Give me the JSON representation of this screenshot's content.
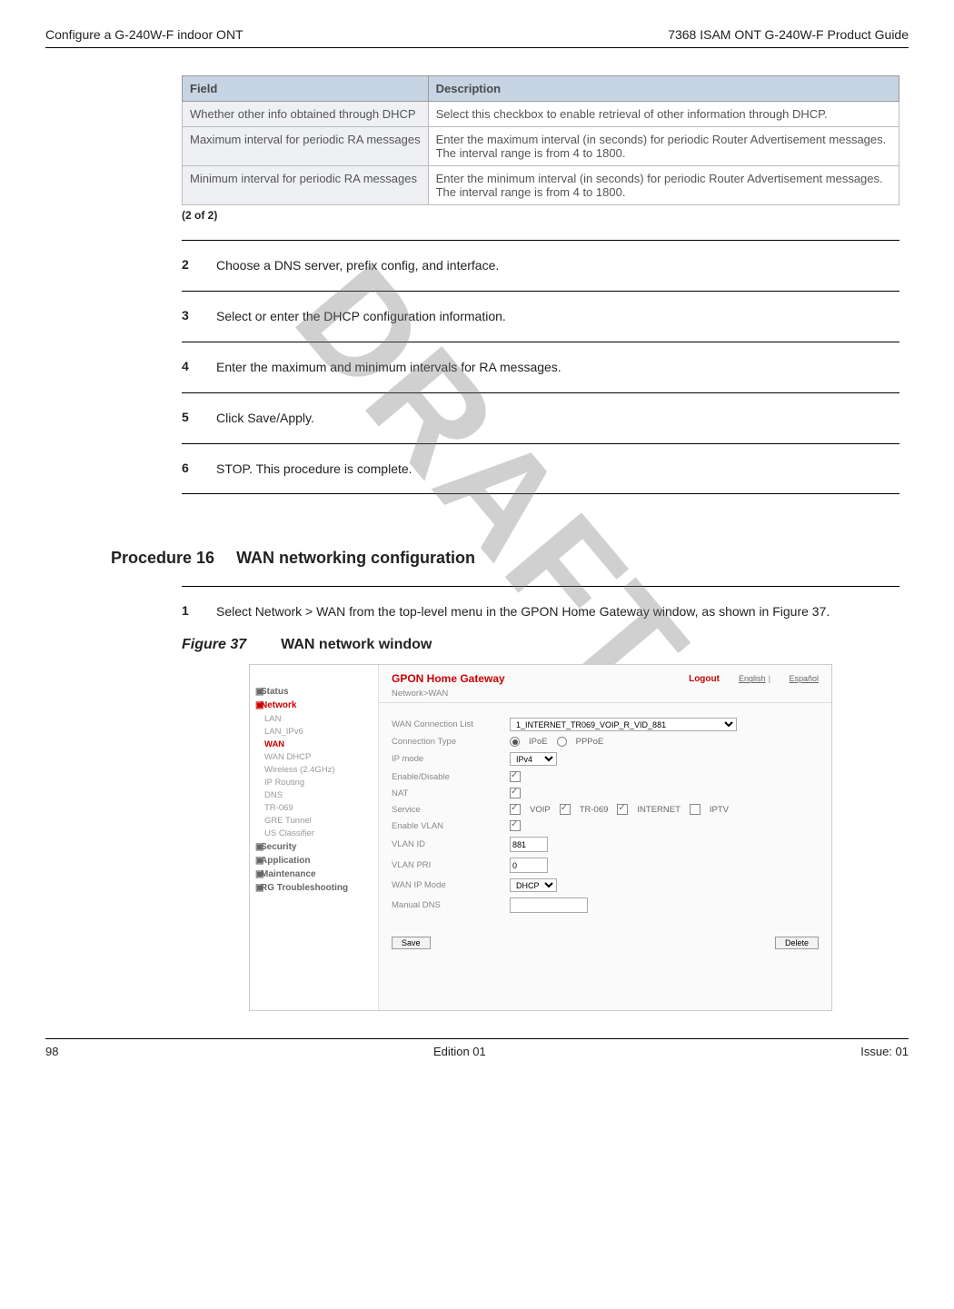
{
  "header": {
    "left": "Configure a G-240W-F indoor ONT",
    "right": "7368 ISAM ONT G-240W-F Product Guide"
  },
  "table": {
    "col1": "Field",
    "col2": "Description",
    "rows": [
      {
        "f": "Whether other info obtained through DHCP",
        "d": "Select this checkbox to enable retrieval of other information through DHCP."
      },
      {
        "f": "Maximum interval for periodic RA messages",
        "d": "Enter the maximum interval (in seconds) for periodic Router Advertisement messages. The interval range is from 4 to 1800."
      },
      {
        "f": "Minimum interval for periodic RA messages",
        "d": "Enter the minimum interval (in seconds) for periodic Router Advertisement messages. The interval range is from 4 to 1800."
      }
    ],
    "caption": "(2 of 2)"
  },
  "steps": [
    {
      "n": "2",
      "t": "Choose a DNS server, prefix config, and interface."
    },
    {
      "n": "3",
      "t": "Select or enter the DHCP configuration information."
    },
    {
      "n": "4",
      "t": "Enter the maximum and minimum intervals for RA messages."
    },
    {
      "n": "5",
      "t": "Click Save/Apply."
    },
    {
      "n": "6",
      "t": "STOP. This procedure is complete."
    }
  ],
  "procedure": {
    "label": "Procedure 16",
    "title": "WAN networking configuration",
    "step1_n": "1",
    "step1_t": "Select Network > WAN from the top-level menu in the GPON Home Gateway window, as shown in Figure 37."
  },
  "figure": {
    "label": "Figure 37",
    "title": "WAN network window"
  },
  "ui": {
    "title": "GPON Home Gateway",
    "logout": "Logout",
    "lang1": "English",
    "lang2": "Español",
    "crumb": "Network>WAN",
    "sidebar": {
      "status": "Status",
      "network": "Network",
      "items": [
        "LAN",
        "LAN_IPv6",
        "WAN",
        "WAN DHCP",
        "Wireless (2.4GHz)",
        "IP Routing",
        "DNS",
        "TR-069",
        "GRE Tunnel",
        "US Classifier"
      ],
      "security": "Security",
      "application": "Application",
      "maintenance": "Maintenance",
      "rgtrouble": "RG Troubleshooting"
    },
    "form": {
      "wan_conn_label": "WAN Connection List",
      "wan_conn_value": "1_INTERNET_TR069_VOIP_R_VID_881",
      "conn_type_label": "Connection Type",
      "ipoe": "IPoE",
      "pppoe": "PPPoE",
      "ip_mode_label": "IP mode",
      "ip_mode_value": "IPv4",
      "enable_label": "Enable/Disable",
      "nat_label": "NAT",
      "service_label": "Service",
      "svc_voip": "VOIP",
      "svc_tr": "TR-069",
      "svc_int": "INTERNET",
      "svc_iptv": "IPTV",
      "enable_vlan_label": "Enable VLAN",
      "vlan_id_label": "VLAN ID",
      "vlan_id_value": "881",
      "vlan_pri_label": "VLAN PRI",
      "vlan_pri_value": "0",
      "wan_ip_mode_label": "WAN IP Mode",
      "wan_ip_mode_value": "DHCP",
      "manual_dns_label": "Manual DNS",
      "save": "Save",
      "delete": "Delete"
    }
  },
  "watermark": "DRAFT",
  "footer": {
    "left": "98",
    "center": "Edition 01",
    "right": "Issue: 01"
  }
}
